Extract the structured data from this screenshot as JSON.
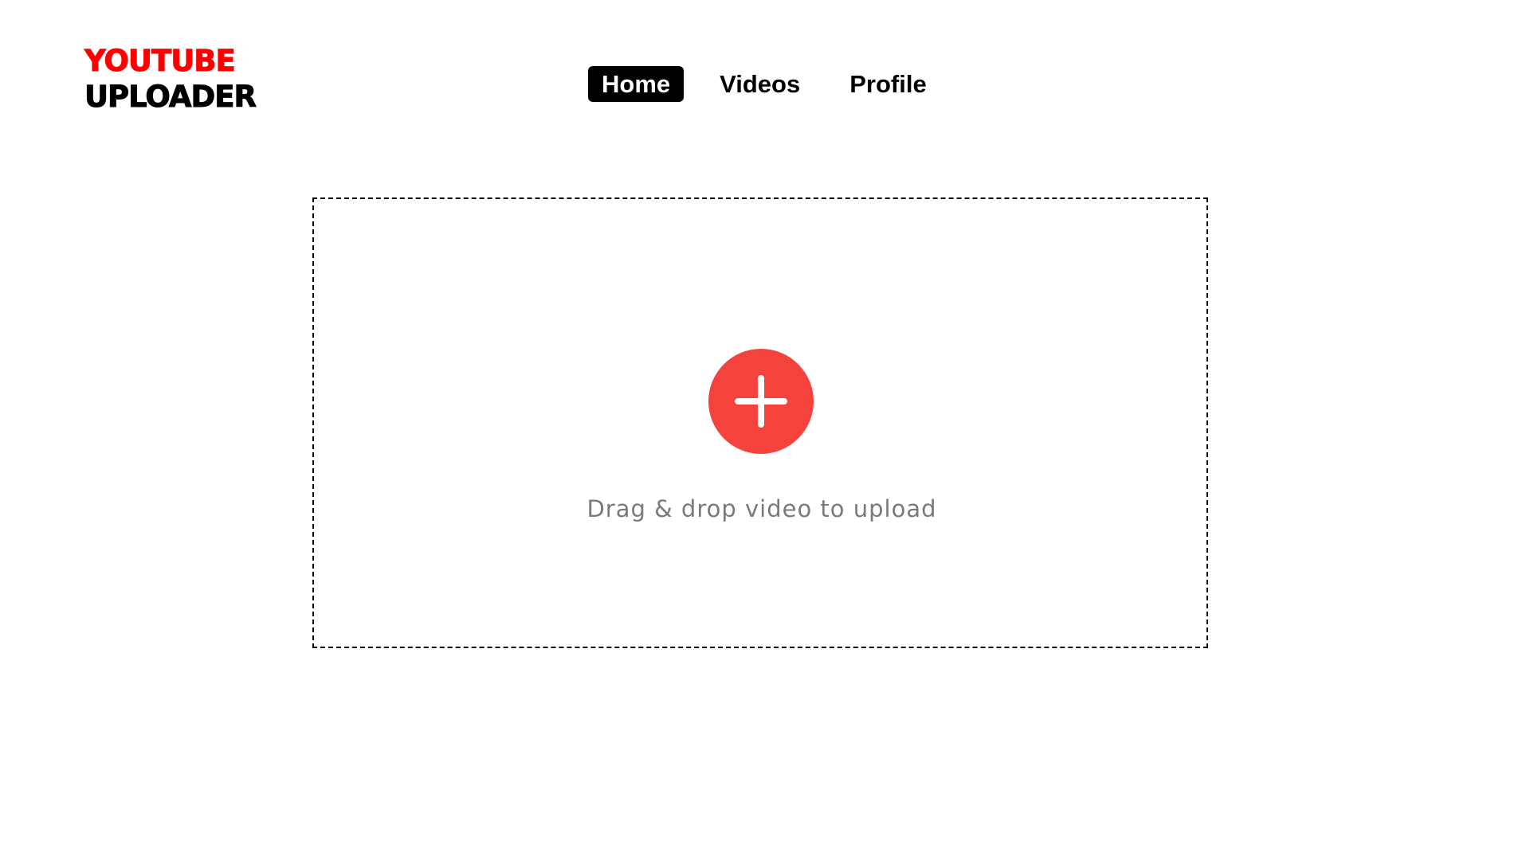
{
  "logo": {
    "line1": "YOUTUBE",
    "line2": "UPLOADER",
    "accent_color": "#ff0000"
  },
  "nav": {
    "items": [
      {
        "label": "Home",
        "active": true
      },
      {
        "label": "Videos",
        "active": false
      },
      {
        "label": "Profile",
        "active": false
      }
    ]
  },
  "upload": {
    "button_icon": "plus-icon",
    "button_color": "#f4433c",
    "prompt": "Drag & drop video to upload"
  }
}
